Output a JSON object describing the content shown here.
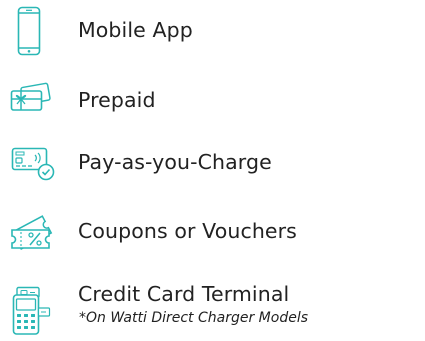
{
  "accent_color": "#2ab7b5",
  "payment_methods": [
    {
      "label": "Mobile App",
      "icon": "smartphone-icon"
    },
    {
      "label": "Prepaid",
      "icon": "gift-card-icon"
    },
    {
      "label": "Pay-as-you-Charge",
      "icon": "credit-card-check-icon"
    },
    {
      "label": "Coupons or Vouchers",
      "icon": "percent-coupon-icon"
    },
    {
      "label": "Credit Card Terminal",
      "icon": "card-terminal-icon",
      "note": "*On Watti Direct Charger Models"
    }
  ]
}
